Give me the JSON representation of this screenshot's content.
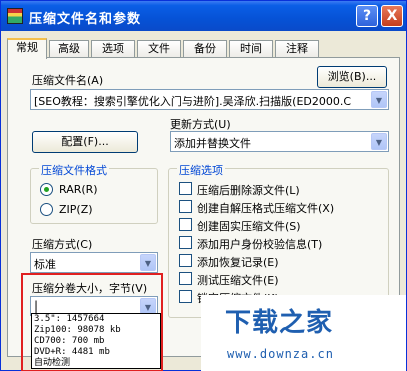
{
  "window": {
    "title": "压缩文件名和参数",
    "help_glyph": "?",
    "close_glyph": "X"
  },
  "tabs": [
    {
      "label": "常规",
      "active": true
    },
    {
      "label": "高级",
      "active": false
    },
    {
      "label": "选项",
      "active": false
    },
    {
      "label": "文件",
      "active": false
    },
    {
      "label": "备份",
      "active": false
    },
    {
      "label": "时间",
      "active": false
    },
    {
      "label": "注释",
      "active": false
    }
  ],
  "archive_name": {
    "label": "压缩文件名(A)",
    "value": "[SEO教程：搜索引擎优化入门与进阶].吴泽欣.扫描版(ED2000.C",
    "browse_label": "浏览(B)..."
  },
  "profile_button": "配置(F)...",
  "update_mode": {
    "label": "更新方式(U)",
    "value": "添加并替换文件"
  },
  "archive_format": {
    "title": "压缩文件格式",
    "options": [
      "RAR(R)",
      "ZIP(Z)"
    ],
    "selected": "RAR(R)"
  },
  "compression_method": {
    "label": "压缩方式(C)",
    "value": "标准"
  },
  "volume_size": {
    "label": "压缩分卷大小，字节(V)",
    "value": "",
    "options": [
      "3.5\":     1457664",
      "Zip100:   98078 kb",
      "CD700:    700 mb",
      "DVD+R:  4481 mb",
      "自动检测"
    ]
  },
  "archive_options": {
    "title": "压缩选项",
    "items": [
      "压缩后删除源文件(L)",
      "创建自解压格式压缩文件(X)",
      "创建固实压缩文件(S)",
      "添加用户身份校验信息(T)",
      "添加恢复记录(E)",
      "测试压缩文件(E)",
      "锁定压缩文件(K)"
    ]
  },
  "watermark": {
    "logo": "下载之家",
    "url": "www.downza.cn"
  },
  "colors": {
    "title_bar": "#0a5ee6",
    "highlight_box": "#e02020",
    "group_title": "#0046d5",
    "watermark": "#1f5fb0"
  }
}
